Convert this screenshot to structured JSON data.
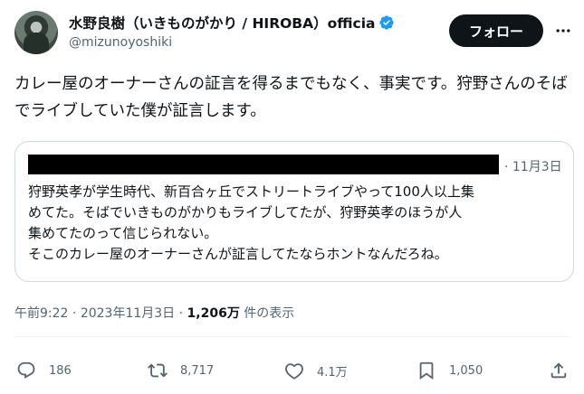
{
  "author": {
    "display_name": "水野良樹（いきものがかり / HIROBA）officia",
    "handle": "@mizunoyoshiki",
    "verified": true
  },
  "header": {
    "follow_label": "フォロー",
    "more_icon": "more-icon"
  },
  "tweet": {
    "text": "カレー屋のオーナーさんの証言を得るまでもなく、事実です。狩野さんのそばでライブしていた僕が証言します。"
  },
  "quote": {
    "date": "· 11月3日",
    "text_lines": [
      "狩野英孝が学生時代、新百合ヶ丘でストリートライブやって100人以上集",
      "めてた。そばでいきものがかりもライブしてたが、狩野英孝のほうが人",
      "集めてたのって信じられない。",
      "そこのカレー屋のオーナーさんが証言してたならホントなんだろね。"
    ]
  },
  "meta": {
    "time": "午前9:22",
    "separator": "·",
    "date": "2023年11月3日",
    "views_count": "1,206万",
    "views_label": "件の表示"
  },
  "actions": {
    "reply_count": "186",
    "retweet_count": "8,717",
    "like_count": "4.1万",
    "bookmark_count": "1,050"
  },
  "colors": {
    "text_primary": "#0f1419",
    "text_secondary": "#536471",
    "verified_blue": "#1d9bf0",
    "border": "#cfd9de"
  }
}
